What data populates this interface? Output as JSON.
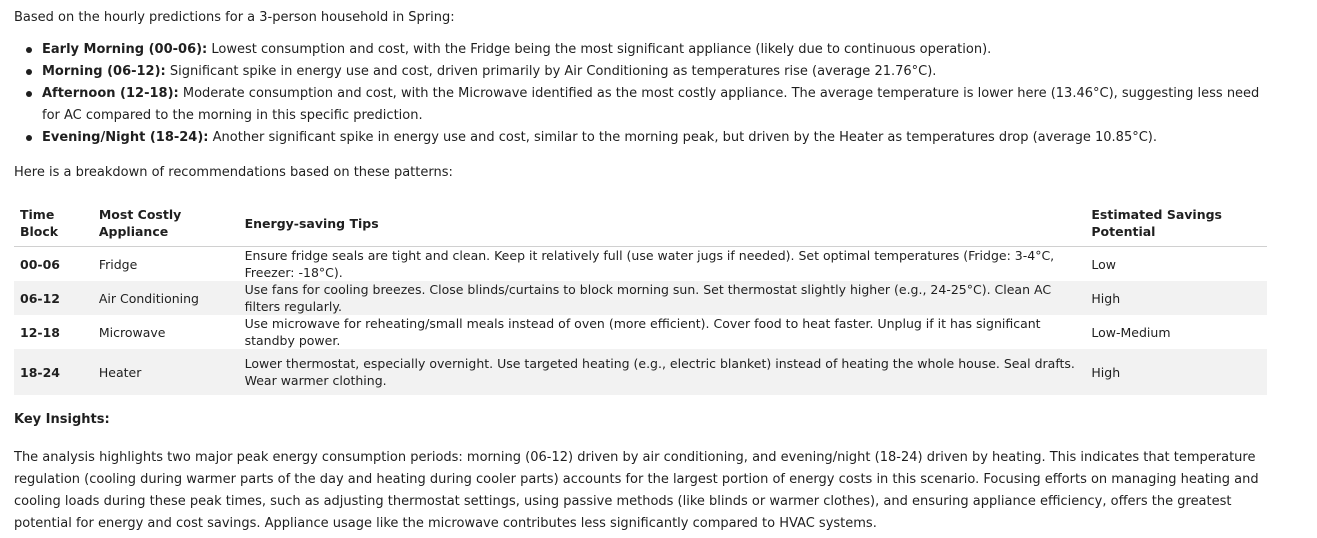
{
  "intro": "Based on the hourly predictions for a 3-person household in Spring:",
  "periods": [
    {
      "label": "Early Morning (00-06):",
      "text": " Lowest consumption and cost, with the Fridge being the most significant appliance (likely due to continuous operation)."
    },
    {
      "label": "Morning (06-12):",
      "text": " Significant spike in energy use and cost, driven primarily by Air Conditioning as temperatures rise (average 21.76°C)."
    },
    {
      "label": "Afternoon (12-18):",
      "text": " Moderate consumption and cost, with the Microwave identified as the most costly appliance. The average temperature is lower here (13.46°C), suggesting less need for AC compared to the morning in this specific prediction."
    },
    {
      "label": "Evening/Night (18-24):",
      "text": " Another significant spike in energy use and cost, similar to the morning peak, but driven by the Heater as temperatures drop (average 10.85°C)."
    }
  ],
  "lead": "Here is a breakdown of recommendations based on these patterns:",
  "table": {
    "headers": {
      "time": "Time Block",
      "appliance": "Most Costly Appliance",
      "tips": "Energy-saving Tips",
      "savings": "Estimated Savings Potential"
    },
    "rows": [
      {
        "time": "00-06",
        "appliance": "Fridge",
        "tips": "Ensure fridge seals are tight and clean. Keep it relatively full (use water jugs if needed). Set optimal temperatures (Fridge: 3-4°C, Freezer: -18°C).",
        "savings": "Low"
      },
      {
        "time": "06-12",
        "appliance": "Air Conditioning",
        "tips": "Use fans for cooling breezes. Close blinds/curtains to block morning sun. Set thermostat slightly higher (e.g., 24-25°C). Clean AC filters regularly.",
        "savings": "High"
      },
      {
        "time": "12-18",
        "appliance": "Microwave",
        "tips": "Use microwave for reheating/small meals instead of oven (more efficient). Cover food to heat faster. Unplug if it has significant standby power.",
        "savings": "Low-Medium"
      },
      {
        "time": "18-24",
        "appliance": "Heater",
        "tips": "Lower thermostat, especially overnight. Use targeted heating (e.g., electric blanket) instead of heating the whole house. Seal drafts. Wear warmer clothing.",
        "savings": "High"
      }
    ]
  },
  "key_insights": {
    "title": "Key Insights:",
    "body": "The analysis highlights two major peak energy consumption periods: morning (06-12) driven by air conditioning, and evening/night (18-24) driven by heating. This indicates that temperature regulation (cooling during warmer parts of the day and heating during cooler parts) accounts for the largest portion of energy costs in this scenario. Focusing efforts on managing heating and cooling loads during these peak times, such as adjusting thermostat settings, using passive methods (like blinds or warmer clothes), and ensuring appliance efficiency, offers the greatest potential for energy and cost savings. Appliance usage like the microwave contributes less significantly compared to HVAC systems."
  }
}
